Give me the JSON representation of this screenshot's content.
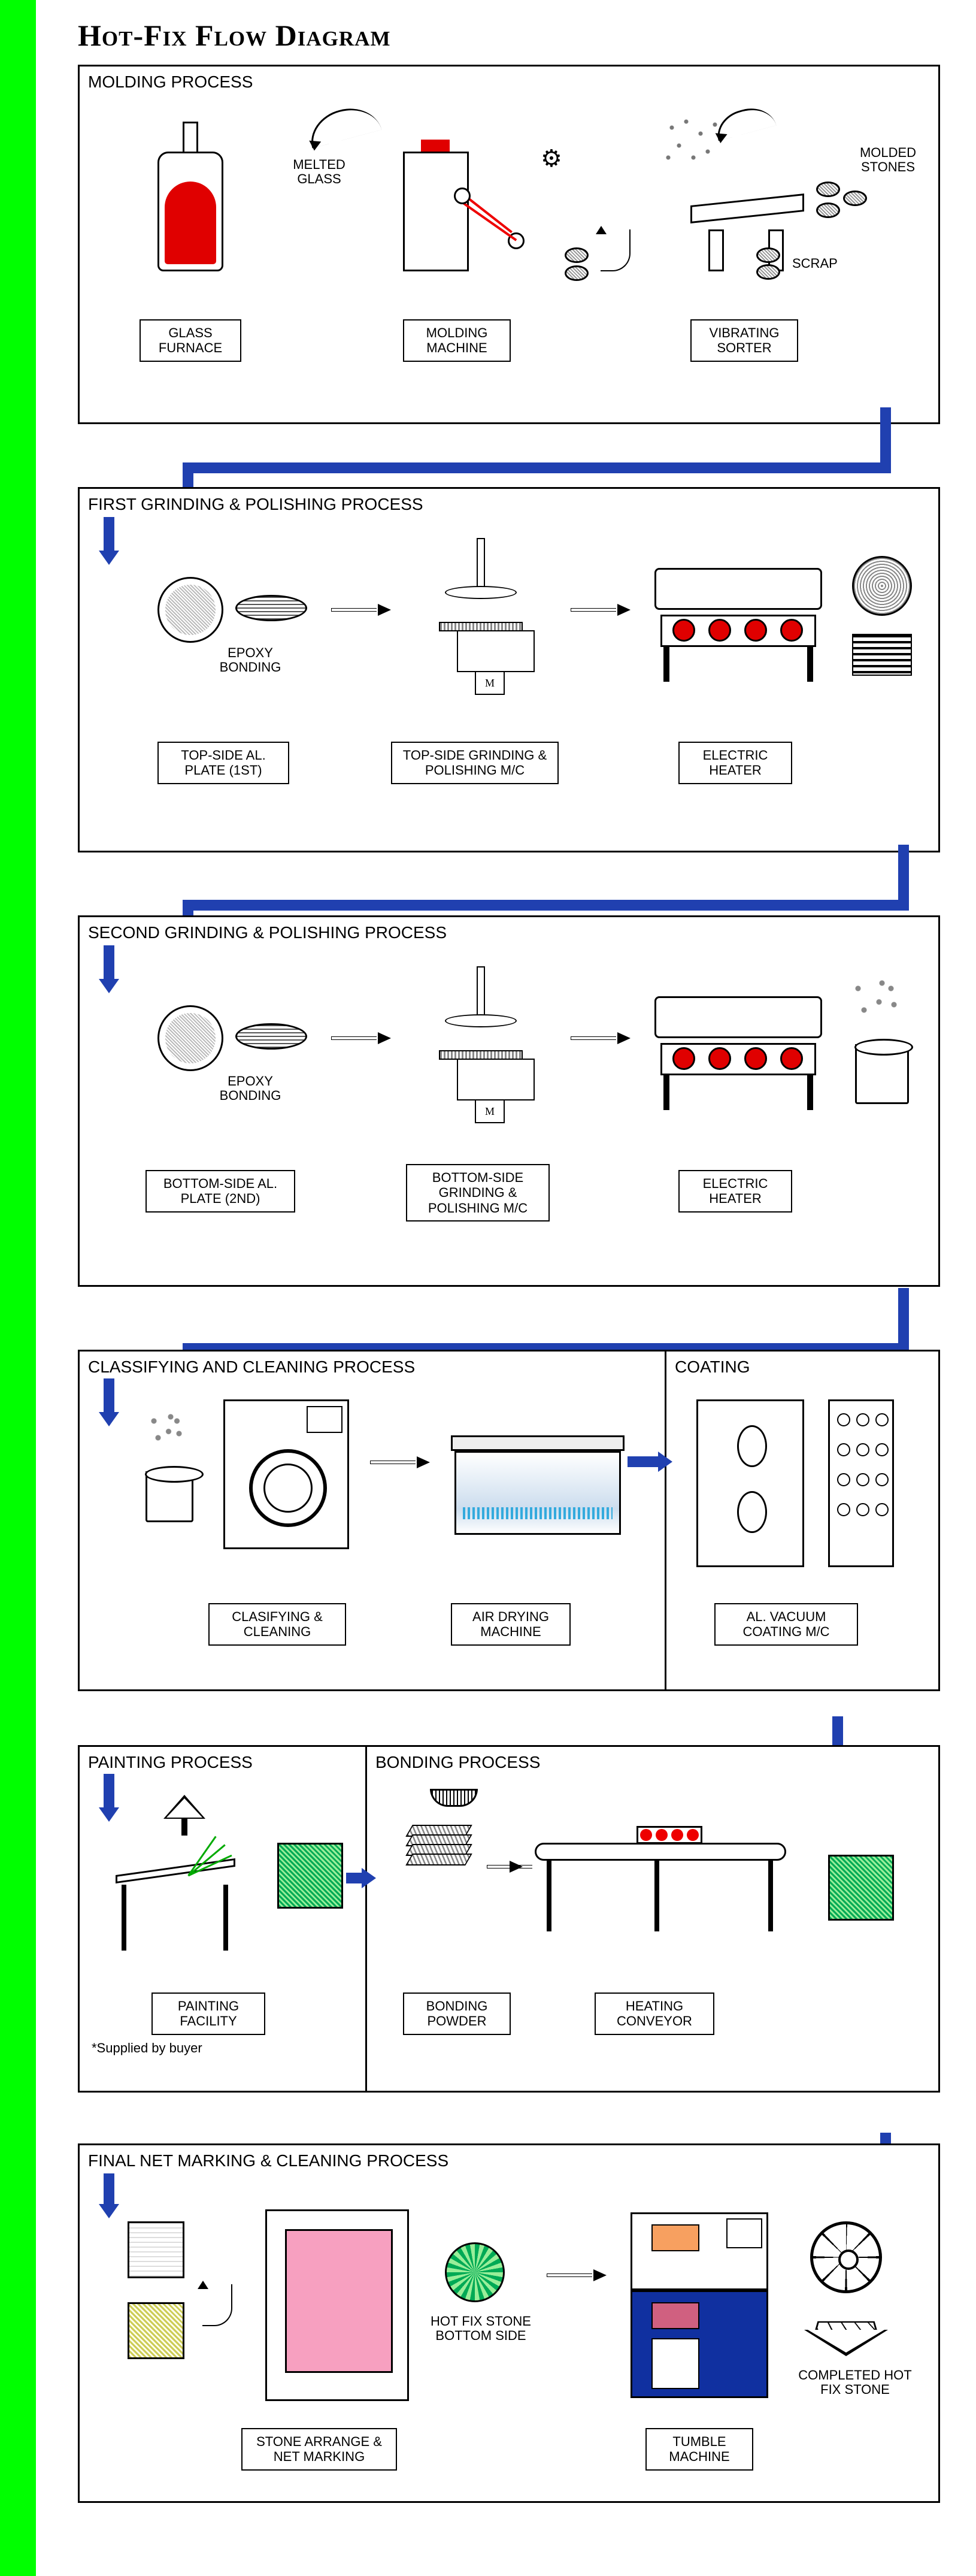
{
  "title": "Hot-Fix Flow Diagram",
  "stages": {
    "s1": {
      "title": "MOLDING PROCESS",
      "melted": "MELTED GLASS",
      "furnace": "GLASS FURNACE",
      "molding": "MOLDING MACHINE",
      "sorter": "VIBRATING SORTER",
      "molded": "MOLDED STONES",
      "scrap": "SCRAP"
    },
    "s2": {
      "title": "FIRST GRINDING & POLISHING PROCESS",
      "epoxy": "EPOXY BONDING",
      "plate": "TOP-SIDE AL. PLATE (1ST)",
      "grind": "TOP-SIDE GRINDING & POLISHING M/C",
      "heater": "ELECTRIC HEATER",
      "motor": "M"
    },
    "s3": {
      "title": "SECOND GRINDING & POLISHING PROCESS",
      "epoxy": "EPOXY BONDING",
      "plate": "BOTTOM-SIDE AL. PLATE (2ND)",
      "grind": "BOTTOM-SIDE GRINDING & POLISHING M/C",
      "heater": "ELECTRIC HEATER",
      "motor": "M"
    },
    "s4": {
      "titleA": "CLASSIFYING AND CLEANING PROCESS",
      "titleB": "COATING",
      "clean": "CLASIFYING & CLEANING",
      "dry": "AIR DRYING MACHINE",
      "coat": "AL. VACUUM COATING M/C"
    },
    "s5": {
      "titleA": "PAINTING PROCESS",
      "titleB": "BONDING PROCESS",
      "paint": "PAINTING FACILITY",
      "foot": "*Supplied by buyer",
      "powder": "BONDING POWDER",
      "conv": "HEATING CONVEYOR"
    },
    "s6": {
      "title": "FINAL NET MARKING & CLEANING PROCESS",
      "arrange": "STONE ARRANGE & NET MARKING",
      "bottom": "HOT FIX STONE BOTTOM SIDE",
      "tumble": "TUMBLE MACHINE",
      "done": "COMPLETED HOT FIX STONE"
    }
  }
}
